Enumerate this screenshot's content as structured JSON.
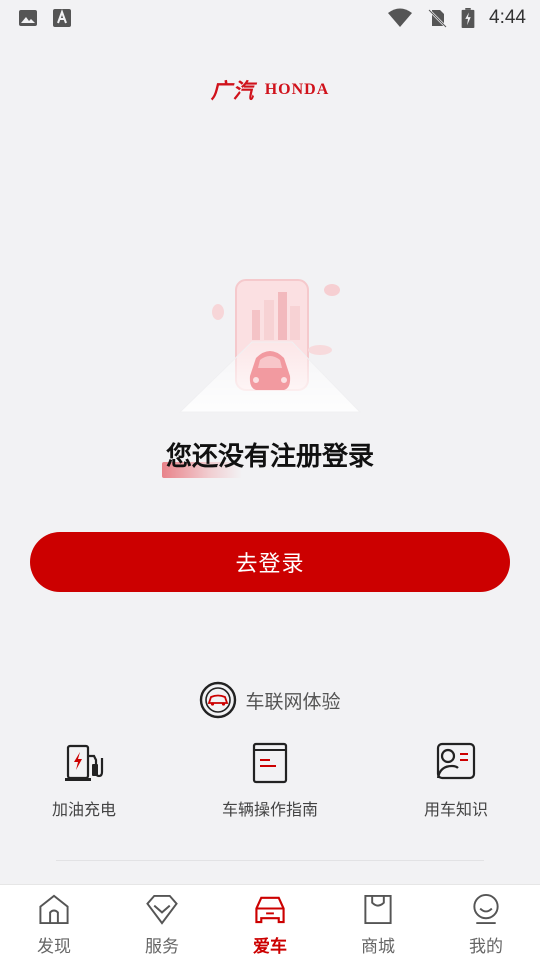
{
  "status_bar": {
    "time": "4:44",
    "left_icons": [
      "image-icon",
      "a-text-icon"
    ],
    "right_icons": [
      "wifi-icon",
      "no-sim-icon",
      "battery-charging-icon"
    ]
  },
  "brand": {
    "name_cn": "广汽",
    "name_en": "HONDA",
    "color": "#d0121b"
  },
  "empty_state": {
    "illustration": "car-on-phone-illustration",
    "title": "您还没有注册登录",
    "login_button": "去登录"
  },
  "connected_car": {
    "label": "车联网体验",
    "icon": "car-steering-icon"
  },
  "shortcuts": [
    {
      "label": "加油充电",
      "icon": "fuel-charge-icon"
    },
    {
      "label": "车辆操作指南",
      "icon": "manual-book-icon"
    },
    {
      "label": "用车知识",
      "icon": "knowledge-card-icon"
    }
  ],
  "bottom_nav": {
    "items": [
      {
        "label": "发现",
        "icon": "home-icon",
        "active": false
      },
      {
        "label": "服务",
        "icon": "diamond-icon",
        "active": false
      },
      {
        "label": "爱车",
        "icon": "car-icon",
        "active": true
      },
      {
        "label": "商城",
        "icon": "shopping-bag-icon",
        "active": false
      },
      {
        "label": "我的",
        "icon": "user-icon",
        "active": false
      }
    ]
  },
  "colors": {
    "accent": "#cc0000",
    "background": "#f2f2f4"
  }
}
